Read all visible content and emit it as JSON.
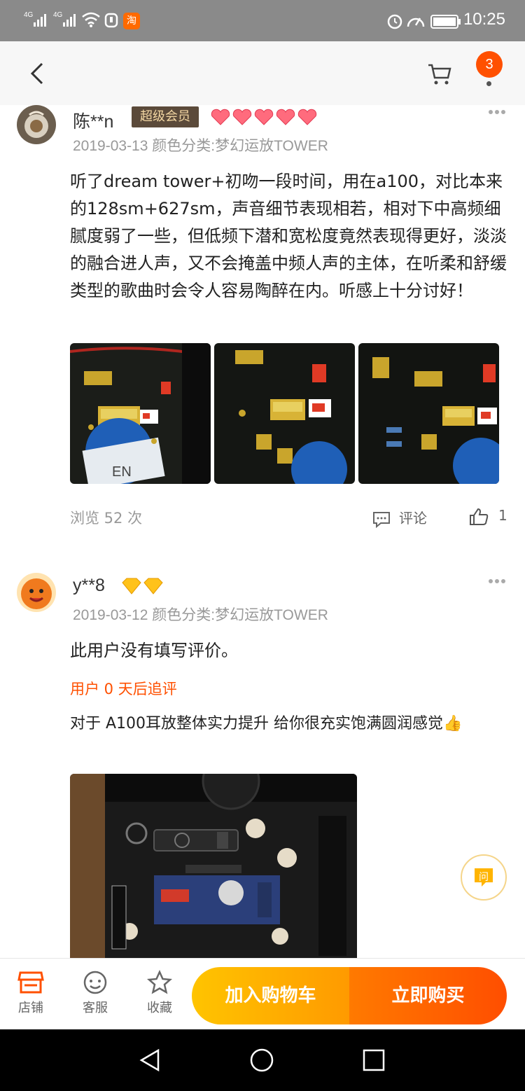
{
  "status": {
    "time": "10:25",
    "sig1": "4G",
    "sig2": "4G",
    "app_badge": "淘"
  },
  "header": {
    "cart_count": "3"
  },
  "reviews": [
    {
      "username": "陈**n",
      "vip_label": "超级会员",
      "date": "2019-03-13",
      "sku": "颜色分类:梦幻运放TOWER",
      "text": "听了dream tower+初吻一段时间，用在a100，对比本来的128sm+627sm，声音细节表现相若，相对下中高频细腻度弱了一些，但低频下潜和宽松度竟然表现得更好，淡淡的融合进人声，又不会掩盖中频人声的主体，在听柔和舒缓类型的歌曲时会令人容易陶醉在内。听感上十分讨好！",
      "views": "浏览 52 次",
      "comment_label": "评论",
      "likes": "1"
    },
    {
      "username": "y**8",
      "date": "2019-03-12",
      "sku": "颜色分类:梦幻运放TOWER",
      "text": "此用户没有填写评价。",
      "followup_title": "用户 0 天后追评",
      "followup_text": "对于 A100耳放整体实力提升  给你很充实饱满圆润感觉👍"
    }
  ],
  "qa_label": "问",
  "bottom": {
    "shop": "店铺",
    "service": "客服",
    "favorite": "收藏",
    "add_cart": "加入购物车",
    "buy_now": "立即购买"
  },
  "colors": {
    "accent": "#ff5000",
    "cart_gradient": "#ffb400",
    "buy_gradient": "#ff5a00"
  }
}
